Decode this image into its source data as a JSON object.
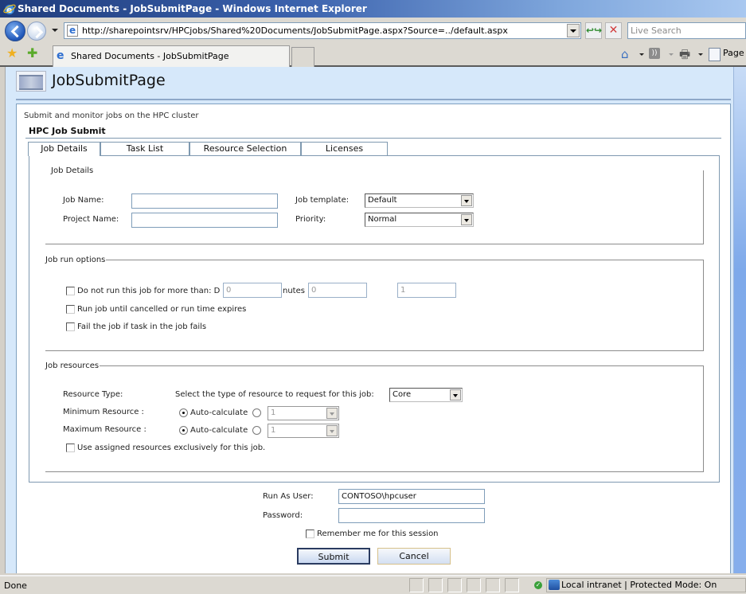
{
  "window": {
    "title": "Shared Documents - JobSubmitPage - Windows Internet Explorer"
  },
  "browser": {
    "address": "http://sharepointsrv/HPCjobs/Shared%20Documents/JobSubmitPage.aspx?Source=../default.aspx",
    "search_placeholder": "Live Search",
    "tab_title": "Shared Documents - JobSubmitPage",
    "page_menu_label": "Page",
    "icons": {
      "back": "back-arrow-icon",
      "forward": "forward-arrow-icon",
      "refresh": "refresh-icon",
      "stop": "stop-x-icon",
      "favorites": "star-icon",
      "add_favorite": "star-plus-icon",
      "home": "home-icon",
      "feeds": "rss-feed-icon",
      "print": "printer-icon",
      "page": "page-icon"
    },
    "refresh_glyph": "↩↪",
    "stop_glyph": "✕",
    "star_glyph": "★",
    "add_fav_glyph": "✚",
    "home_glyph": "⌂",
    "feed_glyph": "))",
    "print_glyph": "🖶",
    "ie_glyph": "e"
  },
  "page": {
    "title": "JobSubmitPage",
    "description": "Submit and monitor jobs on the HPC cluster",
    "webpart_title": "HPC Job Submit",
    "tabs": [
      {
        "label": "Job Details",
        "active": true
      },
      {
        "label": "Task List",
        "active": false
      },
      {
        "label": "Resource Selection",
        "active": false
      },
      {
        "label": "Licenses",
        "active": false
      }
    ],
    "job_details": {
      "legend": "Job Details",
      "job_name_label": "Job Name:",
      "job_name_value": "",
      "project_name_label": "Project Name:",
      "project_name_value": "",
      "job_template_label": "Job template:",
      "job_template_value": "Default",
      "priority_label": "Priority:",
      "priority_value": "Normal"
    },
    "run_options": {
      "legend": "Job run options",
      "max_runtime_label": "Do not run this job for more than: D",
      "days_value": "0",
      "minutes_label": "nutes",
      "minutes_value": "0",
      "third_value": "1",
      "run_until_cancelled_label": "Run job until cancelled or run time expires",
      "fail_on_task_label": "Fail the job if task in the job fails",
      "max_runtime_checked": false,
      "run_until_cancelled_checked": false,
      "fail_on_task_checked": false
    },
    "resources": {
      "legend": "Job resources",
      "resource_type_label": "Resource Type:",
      "resource_type_prompt": "Select the type of resource to request for this job:",
      "resource_type_value": "Core",
      "min_label": "Minimum Resource :",
      "max_label": "Maximum Resource :",
      "auto_calc_label": "Auto-calculate",
      "min_value": "1",
      "max_value": "1",
      "min_auto_selected": true,
      "max_auto_selected": true,
      "exclusive_label": "Use assigned resources exclusively for this job.",
      "exclusive_checked": false
    },
    "credentials": {
      "run_as_label": "Run As User:",
      "run_as_value": "CONTOSO\\hpcuser",
      "password_label": "Password:",
      "password_value": "",
      "remember_label": "Remember me for this session",
      "remember_checked": false
    },
    "buttons": {
      "submit": "Submit",
      "cancel": "Cancel"
    }
  },
  "status": {
    "text": "Done",
    "zone": "Local intranet | Protected Mode: On"
  }
}
